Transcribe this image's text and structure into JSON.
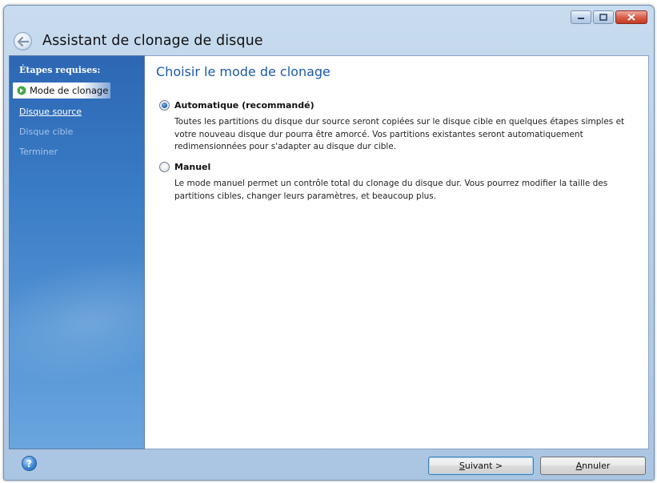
{
  "window": {
    "title": "Assistant de clonage de disque"
  },
  "sidebar": {
    "header": "Étapes requises:",
    "steps": [
      {
        "label": "Mode de clonage",
        "state": "active"
      },
      {
        "label": "Disque source",
        "state": "link"
      },
      {
        "label": "Disque cible",
        "state": "disabled"
      },
      {
        "label": "Terminer",
        "state": "disabled"
      }
    ]
  },
  "main": {
    "title": "Choisir le mode de clonage",
    "options": [
      {
        "label": "Automatique (recommandé)",
        "checked": true,
        "description": "Toutes les partitions du disque dur source seront copiées sur le disque cible en quelques étapes simples et votre nouveau disque dur pourra être amorcé. Vos partitions existantes seront automatiquement redimensionnées pour s'adapter au disque dur cible."
      },
      {
        "label": "Manuel",
        "checked": false,
        "description": "Le mode manuel permet un contrôle total du clonage du disque dur. Vous pourrez modifier la taille des partitions cibles, changer leurs paramètres, et beaucoup plus."
      }
    ]
  },
  "footer": {
    "help_icon": "help-icon",
    "next_mnemonic": "S",
    "next_rest": "uivant >",
    "cancel_mnemonic": "A",
    "cancel_rest": "nnuler"
  },
  "colors": {
    "sidebar": "#3a7cc6",
    "title": "#1d5aa8"
  }
}
